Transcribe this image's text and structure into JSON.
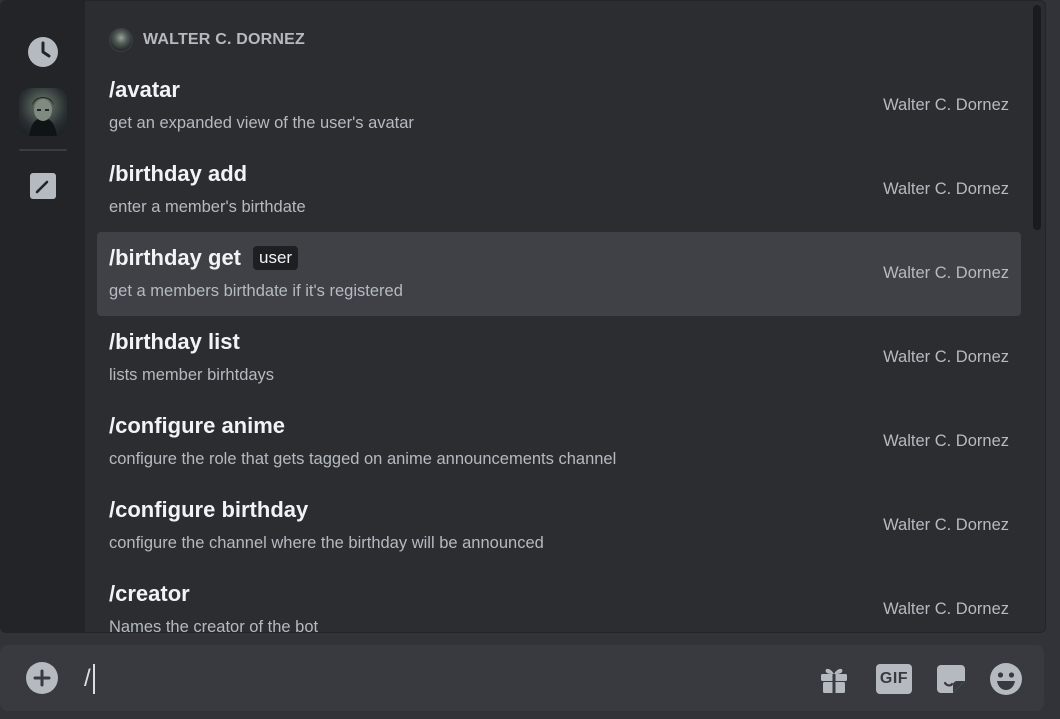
{
  "section": {
    "title": "WALTER C. DORNEZ"
  },
  "commands": [
    {
      "name": "/avatar",
      "option": "",
      "description": "get an expanded view of the user's avatar",
      "source": "Walter C. Dornez"
    },
    {
      "name": "/birthday add",
      "option": "",
      "description": "enter a member's birthdate",
      "source": "Walter C. Dornez"
    },
    {
      "name": "/birthday get",
      "option": "user",
      "description": "get a members birthdate if it's registered",
      "source": "Walter C. Dornez"
    },
    {
      "name": "/birthday list",
      "option": "",
      "description": "lists member birhtdays",
      "source": "Walter C. Dornez"
    },
    {
      "name": "/configure anime",
      "option": "",
      "description": "configure the role that gets tagged on anime announcements channel",
      "source": "Walter C. Dornez"
    },
    {
      "name": "/configure birthday",
      "option": "",
      "description": "configure the channel where the birthday will be announced",
      "source": "Walter C. Dornez"
    },
    {
      "name": "/creator",
      "option": "",
      "description": "Names the creator of the bot",
      "source": "Walter C. Dornez"
    }
  ],
  "chat": {
    "input_value": "/",
    "gif_label": "GIF"
  },
  "icons": {
    "rail": [
      "clock-icon",
      "bot-avatar",
      "pencil-icon"
    ],
    "toolbar": [
      "plus-icon",
      "gift-icon",
      "gif-icon",
      "sticker-icon",
      "emoji-icon"
    ]
  },
  "colors": {
    "background": "#313338",
    "popup": "#2b2d31",
    "rail": "#232428",
    "selected_row": "#3f4147",
    "chatbar": "#383a40"
  }
}
